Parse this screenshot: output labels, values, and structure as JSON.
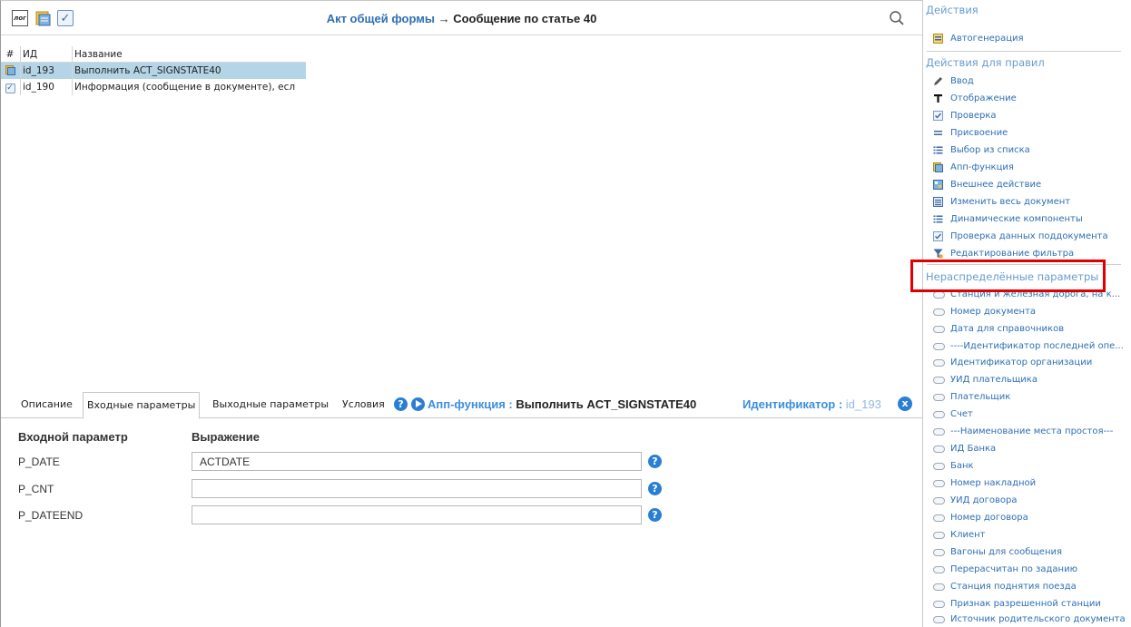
{
  "toolbar": {
    "log_label": "лог",
    "title_part1": "Акт общей формы",
    "title_arrow": "→",
    "title_part2": "Сообщение по статье 40"
  },
  "grid": {
    "headers": [
      "#",
      "ИД",
      "Название"
    ],
    "rows": [
      {
        "id": "id_193",
        "name": "Выполнить ACT_SIGNSTATE40",
        "icon": "app-function-icon",
        "selected": true
      },
      {
        "id": "id_190",
        "name": "Информация (сообщение в документе), есл",
        "icon": "check-icon",
        "selected": false
      }
    ]
  },
  "tabs": {
    "items": [
      "Описание",
      "Входные параметры",
      "Выходные параметры",
      "Условия"
    ],
    "active": "Входные параметры",
    "help_glyph": "?",
    "func_label": "Апп-функция :",
    "func_name": "Выполнить ACT_SIGNSTATE40",
    "ident_label": "Идентификатор :",
    "ident_value": "id_193",
    "close_glyph": "x"
  },
  "params": {
    "header_param": "Входной параметр",
    "header_expr": "Выражение",
    "rows": [
      {
        "name": "P_DATE",
        "value": "ACTDATE"
      },
      {
        "name": "P_CNT",
        "value": ""
      },
      {
        "name": "P_DATEEND",
        "value": ""
      }
    ]
  },
  "right": {
    "actions_title": "Действия",
    "autogen": "Автогенерация",
    "rule_actions_title": "Действия для правил",
    "rule_actions": [
      {
        "label": "Ввод",
        "icon": "pencil-icon"
      },
      {
        "label": "Отображение",
        "icon": "text-t-icon"
      },
      {
        "label": "Проверка",
        "icon": "check-icon"
      },
      {
        "label": "Присвоение",
        "icon": "equals-icon"
      },
      {
        "label": "Выбор из списка",
        "icon": "list-icon"
      },
      {
        "label": "Апп-функция",
        "icon": "app-function-icon"
      },
      {
        "label": "Внешнее действие",
        "icon": "external-action-icon"
      },
      {
        "label": "Изменить весь документ",
        "icon": "document-edit-icon"
      },
      {
        "label": "Динамические компоненты",
        "icon": "list-icon"
      },
      {
        "label": "Проверка данных поддокумента",
        "icon": "check-icon"
      },
      {
        "label": "Редактирование фильтра",
        "icon": "filter-icon"
      }
    ],
    "unassigned_title": "Нераспределённые параметры",
    "unassigned": [
      "Станция и железная дорога, на к...",
      "Номер документа",
      "Дата для справочников",
      "----Идентификатор последней опе...",
      "Идентификатор организации",
      "УИД плательщика",
      "Плательщик",
      "Счет",
      "---Наименование места простоя---",
      "ИД Банка",
      "Банк",
      "Номер накладной",
      "УИД договора",
      "Номер договора",
      "Клиент",
      "Вагоны для сообщения",
      "Перерасчитан по заданию",
      "Станция поднятия поезда",
      "Признак разрешенной станции",
      "Источник родительского документа"
    ]
  },
  "colors": {
    "link": "#2f6fb3",
    "section": "#6a9cd0",
    "accent": "#2a7fd4",
    "selection": "#b4d5e6",
    "highlight_box": "#e00000"
  }
}
